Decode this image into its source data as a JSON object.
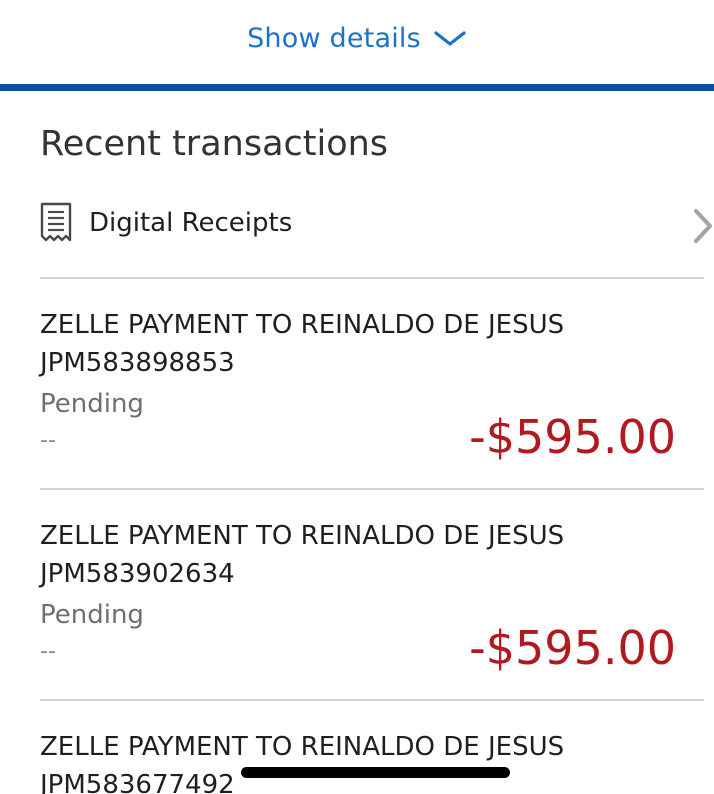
{
  "header": {
    "show_details_label": "Show details",
    "chevron_icon": "chevron-down-icon",
    "accent_color": "#1a73c8",
    "rule_color": "#0c4ea3"
  },
  "recent": {
    "title": "Recent transactions",
    "receipts": {
      "label": "Digital Receipts",
      "icon": "receipt-icon",
      "chevron_icon": "chevron-right-icon"
    }
  },
  "transactions": [
    {
      "description": "ZELLE PAYMENT TO REINALDO DE JESUS",
      "reference": "JPM583898853",
      "status": "Pending",
      "detail": "--",
      "amount": "-$595.00"
    },
    {
      "description": "ZELLE PAYMENT TO REINALDO DE JESUS",
      "reference": "JPM583902634",
      "status": "Pending",
      "detail": "--",
      "amount": "-$595.00"
    },
    {
      "description": "ZELLE PAYMENT TO REINALDO DE JESUS",
      "reference": "JPM583677492"
    }
  ],
  "colors": {
    "amount_negative": "#b0191e",
    "status_text": "#6f6f6f"
  }
}
